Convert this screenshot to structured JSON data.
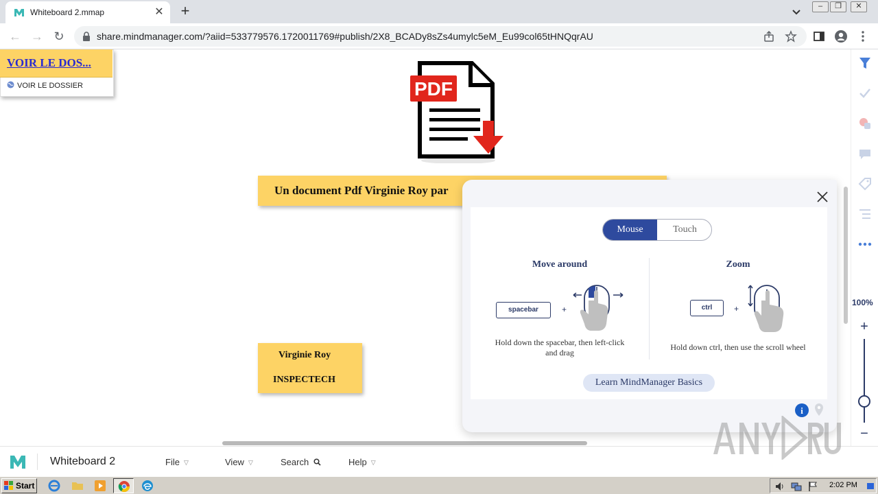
{
  "browser": {
    "tab_title": "Whiteboard 2.mmap",
    "url": "share.mindmanager.com/?aiid=533779576.1720011769#publish/2X8_BCADy8sZs4umylc5eM_Eu99col65tHNQqrAU"
  },
  "canvas": {
    "pdf_label": "PDF",
    "main_topic": "Un document Pdf Virginie Roy par",
    "link_topic": {
      "title": "VOIR LE DOS...",
      "subtitle": "VOIR LE DOSSIER"
    },
    "person_topic": {
      "line1": "Virginie Roy",
      "line2": "INSPECTECH"
    }
  },
  "popup": {
    "tabs": {
      "mouse": "Mouse",
      "touch": "Touch"
    },
    "move": {
      "title": "Move around",
      "key": "spacebar",
      "plus": "+",
      "desc": "Hold down the spacebar, then left-click and drag"
    },
    "zoom": {
      "title": "Zoom",
      "key": "ctrl",
      "plus": "+",
      "desc": "Hold down ctrl, then use the scroll wheel"
    },
    "learn_button": "Learn MindManager Basics",
    "info_label": "i"
  },
  "zoom": {
    "label": "100%",
    "plus": "+",
    "minus": "−"
  },
  "appbar": {
    "doc_title": "Whiteboard 2",
    "menus": {
      "file": "File",
      "view": "View",
      "search": "Search",
      "help": "Help"
    }
  },
  "taskbar": {
    "start": "Start",
    "clock": "2:02 PM"
  },
  "colors": {
    "topic_fill": "#fdd365",
    "brand_navy": "#2b3a67",
    "segment_active": "#2e4a9e",
    "link_blue": "#2b2bd0"
  },
  "icons": {
    "tab_favicon": "mindmanager-logo-icon",
    "right_sidebar": [
      "filter-icon",
      "check-icon",
      "priority-icon",
      "comment-icon",
      "tag-icon",
      "outline-icon",
      "more-icon"
    ]
  }
}
